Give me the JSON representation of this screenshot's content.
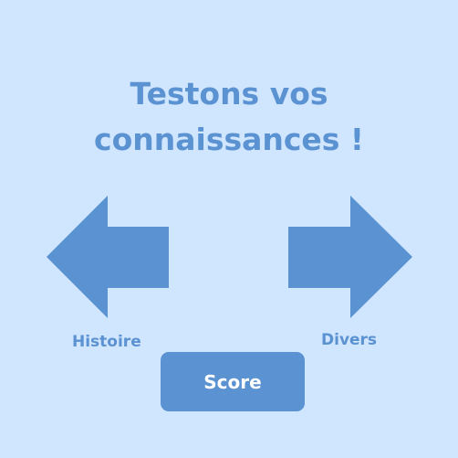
{
  "title_line1": "Testons vos",
  "title_line2": "connaissances !",
  "left_label": "Histoire",
  "right_label": "Divers",
  "score_label": "Score",
  "colors": {
    "background": "#d0e5fe",
    "accent": "#5a92d2",
    "button_text": "#ffffff"
  }
}
